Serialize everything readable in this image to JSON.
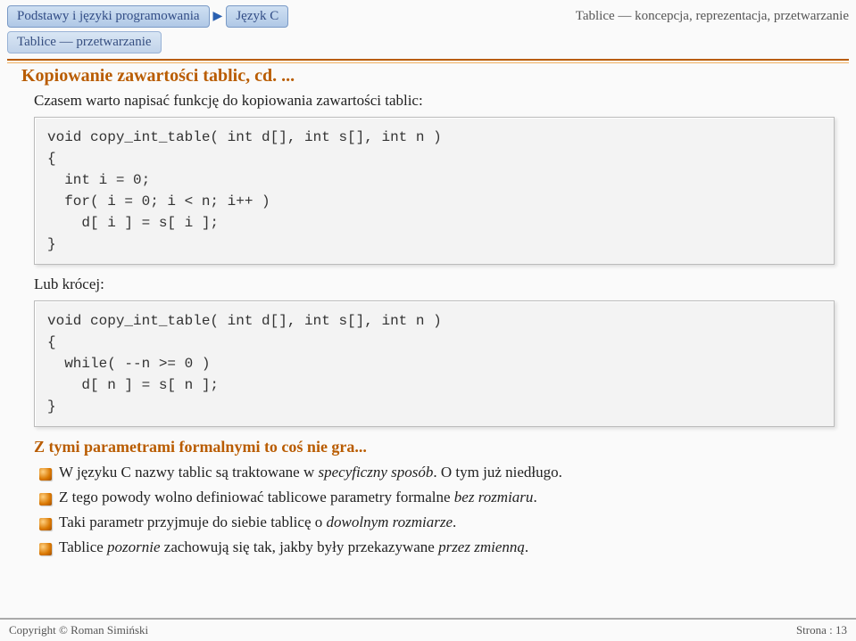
{
  "header": {
    "breadcrumb1": "Podstawy i języki programowania",
    "breadcrumb2": "Język C",
    "right": "Tablice — koncepcja, reprezentacja, przetwarzanie"
  },
  "section_tag": "Tablice — przetwarzanie",
  "title": "Kopiowanie zawartości tablic, cd. ...",
  "intro": "Czasem warto napisać funkcję do kopiowania zawartości tablic:",
  "code1": "void copy_int_table( int d[], int s[], int n )\n{\n  int i = 0;\n  for( i = 0; i < n; i++ )\n    d[ i ] = s[ i ];\n}",
  "shorter_label": "Lub krócej:",
  "code2": "void copy_int_table( int d[], int s[], int n )\n{\n  while( --n >= 0 )\n    d[ n ] = s[ n ];\n}",
  "subhead": "Z tymi parametrami formalnymi to coś nie gra...",
  "bullets": {
    "b0_a": "W języku C nazwy tablic są traktowane w ",
    "b0_em": "specyficzny sposób",
    "b0_b": ". O tym już niedługo.",
    "b1_a": "Z tego powody wolno definiować tablicowe parametry formalne ",
    "b1_em": "bez rozmiaru",
    "b1_b": ".",
    "b2_a": "Taki parametr przyjmuje do siebie tablicę o ",
    "b2_em": "dowolnym rozmiarze",
    "b2_b": ".",
    "b3_a": "Tablice ",
    "b3_em1": "pozornie",
    "b3_b": " zachowują się tak, jakby były przekazywane ",
    "b3_em2": "przez zmienną",
    "b3_c": "."
  },
  "footer": {
    "left": "Copyright © Roman Simiński",
    "right": "Strona : 13"
  }
}
